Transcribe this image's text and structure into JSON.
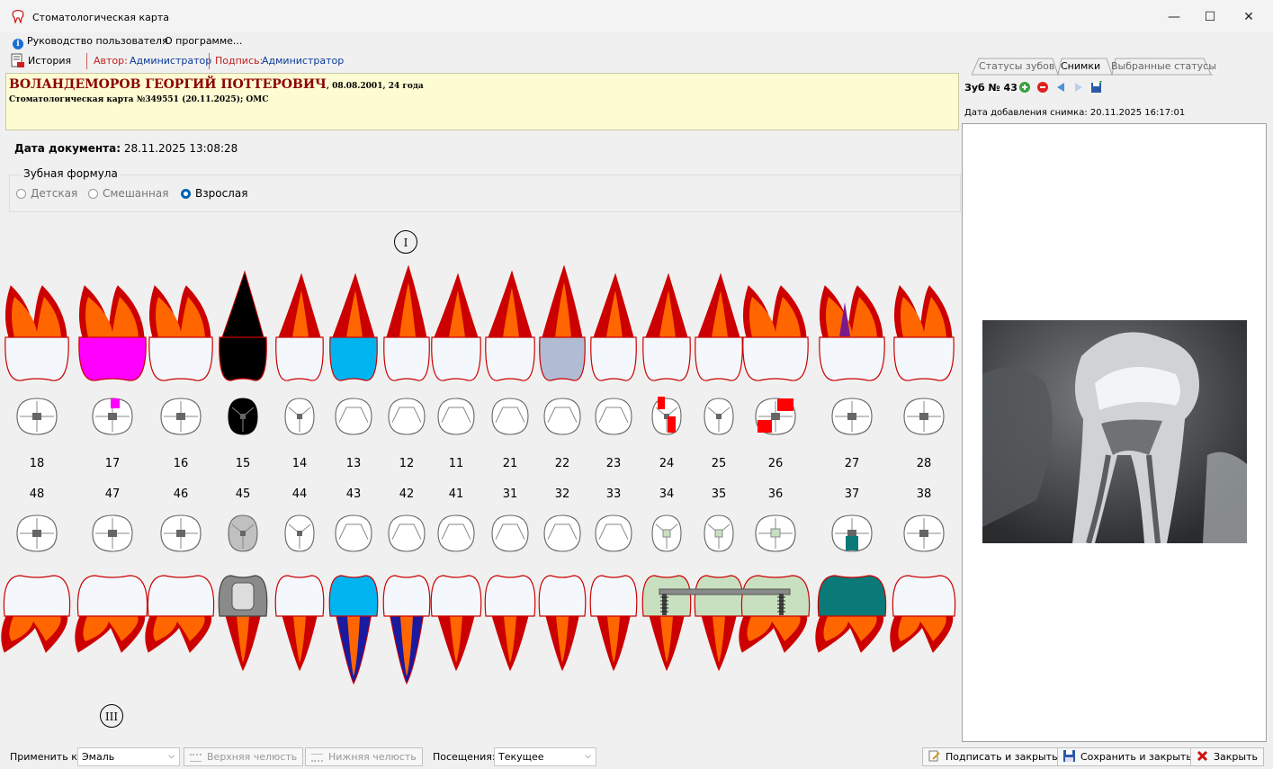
{
  "window": {
    "title": "Стоматологическая карта",
    "min": "—",
    "max": "☐",
    "close": "✕"
  },
  "menu": {
    "guide": "Руководство пользователя",
    "about": "О программе..."
  },
  "toolbar": {
    "history": "История",
    "author_label": "Автор:",
    "author": "Администратор",
    "signature_label": "Подпись:",
    "signature": "Администратор"
  },
  "patient": {
    "name": "ВОЛАНДЕМОРОВ ГЕОРГИЙ ПОТТЕРОВИЧ",
    "details": ", 08.08.2001, 24 года",
    "card": "Стоматологическая карта №349551 (20.11.2025); ОМС"
  },
  "document": {
    "date_label": "Дата документа:",
    "date": "28.11.2025 13:08:28"
  },
  "formula": {
    "legend": "Зубная формула",
    "options": [
      "Детская",
      "Смешанная",
      "Взрослая"
    ],
    "selected": "Взрослая"
  },
  "quadrants": {
    "upper": "I",
    "lower": "III"
  },
  "upper_numbers": [
    "18",
    "17",
    "16",
    "15",
    "14",
    "13",
    "12",
    "11",
    "21",
    "22",
    "23",
    "24",
    "25",
    "26",
    "27",
    "28"
  ],
  "lower_numbers": [
    "48",
    "47",
    "46",
    "45",
    "44",
    "43",
    "42",
    "41",
    "31",
    "32",
    "33",
    "34",
    "35",
    "36",
    "37",
    "38"
  ],
  "tooth_colors": {
    "enamel": "#f4f8fd",
    "root": "#cc0000",
    "root_core": "#ff6600",
    "caries": "#ff00ff",
    "pulpitis_black": "#000000",
    "filling_blue": "#00b4f0",
    "crown_gray": "#b0bcd4",
    "metal": "#8a8a8a",
    "implant_green": "#c8e0c0",
    "teal": "#0a7a78",
    "canal_blue": "#1a1aa0",
    "red_spot": "#ff0000"
  },
  "right_panel": {
    "tabs": [
      "Статусы зубов",
      "Снимки",
      "Выбранные статусы"
    ],
    "active_tab": "Снимки",
    "tooth": "Зуб № 43",
    "image_date_label": "Дата добавления снимка:",
    "image_date": "20.11.2025 16:17:01"
  },
  "statusbar": {
    "apply_label": "Применить к:",
    "apply_value": "Эмаль",
    "upper_jaw": "Верхняя челюсть",
    "lower_jaw": "Нижняя челюсть",
    "visits_label": "Посещения:",
    "visits_value": "Текущее",
    "sign_close": "Подписать и закрыть",
    "save_close": "Сохранить и закрыть",
    "close": "Закрыть"
  }
}
